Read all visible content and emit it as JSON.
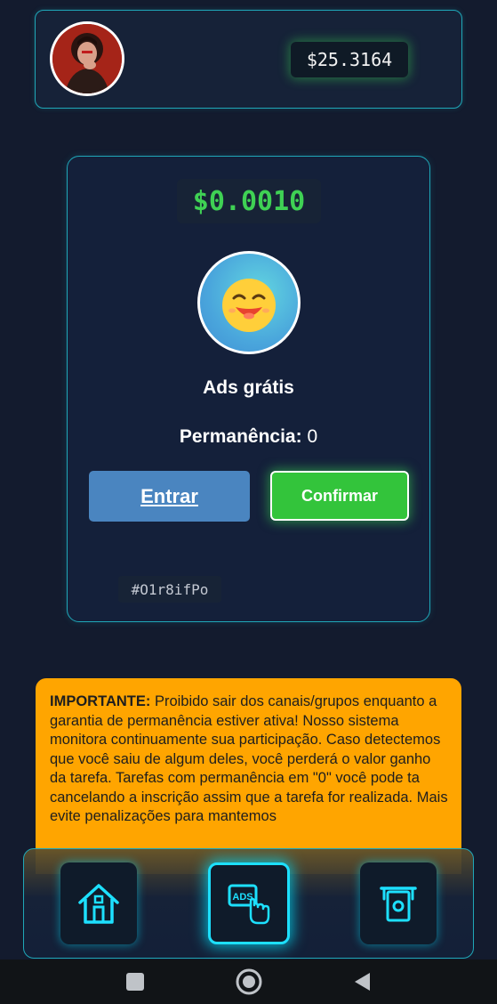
{
  "header": {
    "avatar_icon": "user-avatar-photo",
    "balance": "$25.3164"
  },
  "task": {
    "reward": "$0.0010",
    "icon": "laughing-emoji-icon",
    "title": "Ads grátis",
    "permanence_label": "Permanência:",
    "permanence_value": "0",
    "enter_label": "Entrar",
    "confirm_label": "Confirmar",
    "code": "#O1r8ifPo"
  },
  "notice": {
    "title": "IMPORTANTE:",
    "text": "Proibido sair dos canais/grupos enquanto a garantia de permanência estiver ativa! Nosso sistema monitora continuamente sua participação. Caso detectemos que você saiu de algum deles, você perderá o valor ganho da tarefa. Tarefas com permanência em \"0\" você pode ta cancelando a inscrição assim que a tarefa for realizada. Mais evite penalizações para mantemos"
  },
  "bottom_nav": [
    {
      "icon": "home-icon",
      "active": false
    },
    {
      "icon": "ads-click-icon",
      "active": true
    },
    {
      "icon": "cash-withdraw-icon",
      "active": false
    }
  ],
  "system_nav": [
    "recents-icon",
    "home-circle-icon",
    "back-icon"
  ],
  "colors": {
    "background": "#131b2e",
    "accent_cyan": "#1fa7b8",
    "reward_green": "#3fd154",
    "confirm_green": "#33c43b",
    "enter_blue": "#4a85c0",
    "notice_orange": "#ffa500"
  }
}
